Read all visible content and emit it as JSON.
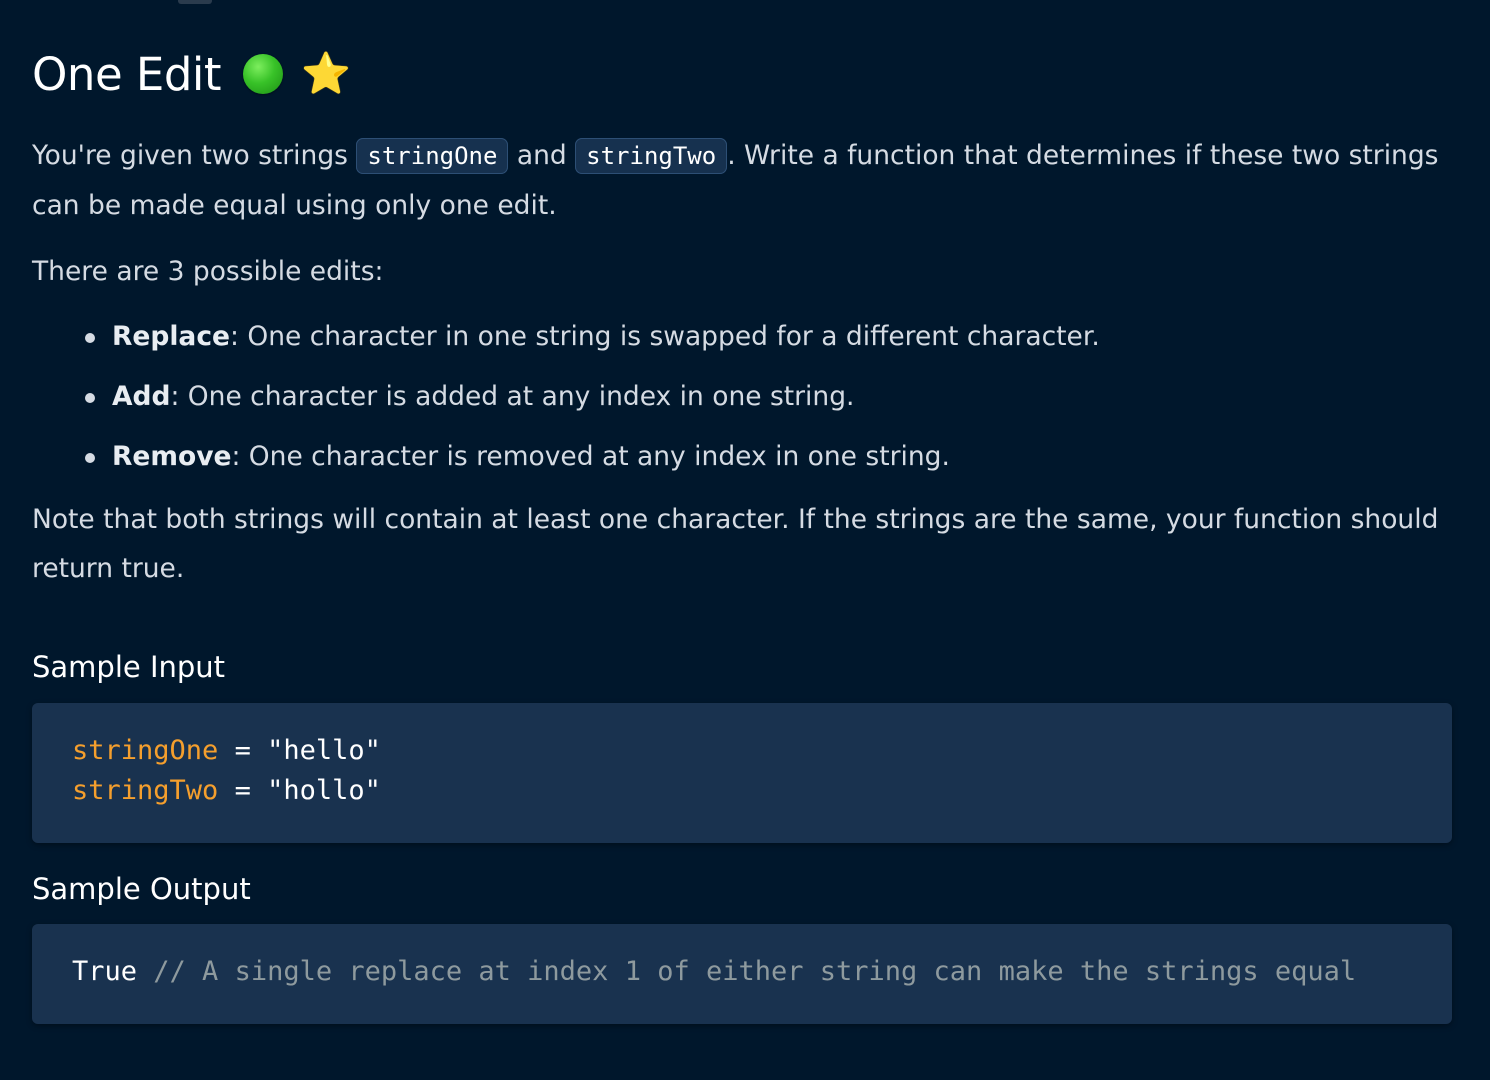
{
  "title": "One Edit",
  "icons": {
    "difficulty": "green-circle-icon",
    "favorite": "star-icon",
    "star_glyph": "⭐"
  },
  "colors": {
    "background": "#00172c",
    "code_background": "#19324f",
    "variable": "#f59f2d",
    "comment": "#8e9a9e",
    "difficulty": "#38c228",
    "star": "#ffcd29"
  },
  "description": {
    "p1_before": "You're given two strings ",
    "code_one": "stringOne",
    "p1_and": " and ",
    "code_two": "stringTwo",
    "p1_after": ". Write a function that determines if these two strings can be made equal using only one edit.",
    "p2": "There are 3 possible edits:",
    "edits": [
      {
        "term": "Replace",
        "text": ": One character in one string is swapped for a different character."
      },
      {
        "term": "Add",
        "text": ": One character is added at any index in one string."
      },
      {
        "term": "Remove",
        "text": ": One character is removed at any index in one string."
      }
    ],
    "p3": "Note that both strings will contain at least one character. If the strings are the same, your function should return true."
  },
  "sample_input": {
    "heading": "Sample Input",
    "lines": [
      {
        "var": "stringOne",
        "op": " = ",
        "value": "\"hello\""
      },
      {
        "var": "stringTwo",
        "op": " = ",
        "value": "\"hollo\""
      }
    ]
  },
  "sample_output": {
    "heading": "Sample Output",
    "value": "True",
    "comment": " // A single replace at index 1 of either string can make the strings equal"
  }
}
